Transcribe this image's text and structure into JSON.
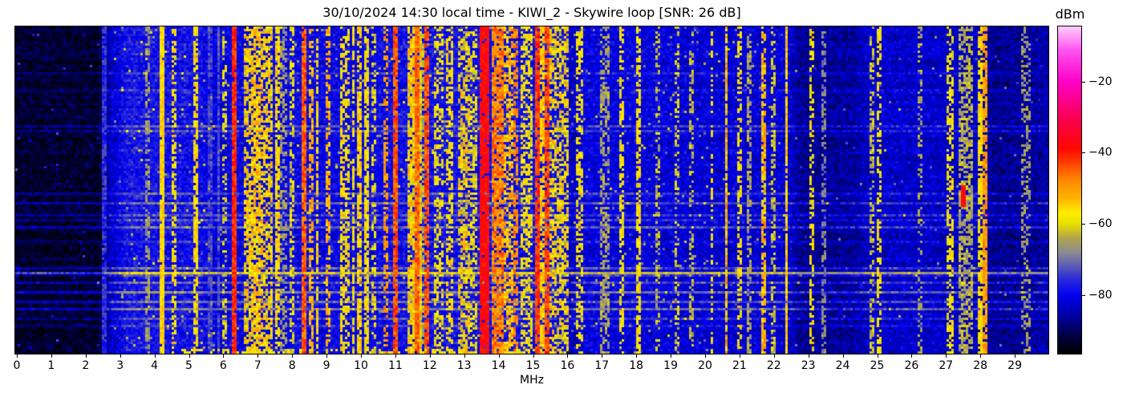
{
  "figure": {
    "kind": "radio spectrum waterfall screenshot"
  },
  "chart_data": {
    "type": "heatmap",
    "title": "30/10/2024 14:30 local time - KIWI_2 - Skywire loop [SNR: 26 dB]",
    "xlabel": "MHz",
    "x_range": [
      0,
      30
    ],
    "x_ticks": [
      0,
      1,
      2,
      3,
      4,
      5,
      6,
      7,
      8,
      9,
      10,
      11,
      12,
      13,
      14,
      15,
      16,
      17,
      18,
      19,
      20,
      21,
      22,
      23,
      24,
      25,
      26,
      27,
      28,
      29
    ],
    "y_ticks": [],
    "grid": false,
    "colorbar": {
      "label": "dBm",
      "ticks": [
        -20,
        -40,
        -60,
        -80
      ],
      "tick_labels": [
        "−20",
        "−40",
        "−60",
        "−80"
      ],
      "vmin": -96.5,
      "vmax": -4.5,
      "colormap_stops": [
        [
          -96.5,
          "#000000"
        ],
        [
          -91,
          "#00004a"
        ],
        [
          -86,
          "#0000a2"
        ],
        [
          -80,
          "#0202f0"
        ],
        [
          -76,
          "#2525dd"
        ],
        [
          -72,
          "#5a5ab8"
        ],
        [
          -68,
          "#8c8c92"
        ],
        [
          -64,
          "#b2a44a"
        ],
        [
          -60,
          "#e8e000"
        ],
        [
          -57,
          "#ffee00"
        ],
        [
          -53,
          "#ffb400"
        ],
        [
          -48,
          "#ff8c00"
        ],
        [
          -42,
          "#ff3300"
        ],
        [
          -39,
          "#ff0800"
        ],
        [
          -31,
          "#f8004a"
        ],
        [
          -20,
          "#ff00c8"
        ],
        [
          -11,
          "#ff55f0"
        ],
        [
          -4.5,
          "#ffccfa"
        ]
      ]
    },
    "background_noise_profile_dbm": [
      [
        0,
        -93
      ],
      [
        2.4,
        -93
      ],
      [
        2.7,
        -84
      ],
      [
        3.2,
        -78
      ],
      [
        5.3,
        -78.5
      ],
      [
        5.6,
        -81
      ],
      [
        7.6,
        -80
      ],
      [
        10,
        -80
      ],
      [
        11,
        -79
      ],
      [
        12.6,
        -78.5
      ],
      [
        15.9,
        -79
      ],
      [
        16.1,
        -84
      ],
      [
        16.4,
        -81
      ],
      [
        18,
        -81
      ],
      [
        20,
        -82
      ],
      [
        22.4,
        -82
      ],
      [
        22.8,
        -87
      ],
      [
        24.3,
        -86
      ],
      [
        24.8,
        -83
      ],
      [
        26.5,
        -83
      ],
      [
        27.9,
        -84
      ],
      [
        28.4,
        -87
      ],
      [
        29.7,
        -86
      ],
      [
        30,
        -85
      ]
    ],
    "signal_bands": [
      {
        "f": 2.54,
        "w": 0.05,
        "level": -76,
        "duty": 0.95
      },
      {
        "f": 3.8,
        "w": 0.06,
        "level": -66,
        "duty": 0.55
      },
      {
        "f": 4.24,
        "w": 0.06,
        "level": -56,
        "duty": 0.97
      },
      {
        "f": 4.59,
        "w": 0.05,
        "level": -57,
        "duty": 0.55
      },
      {
        "f": 5.17,
        "w": 0.07,
        "level": -57,
        "duty": 0.72
      },
      {
        "f": 5.63,
        "w": 0.04,
        "level": -74,
        "duty": 0.9
      },
      {
        "f": 5.85,
        "w": 0.04,
        "level": -73,
        "duty": 0.9
      },
      {
        "f": 6.04,
        "w": 0.05,
        "level": -61,
        "duty": 0.45
      },
      {
        "f": 6.32,
        "w": 0.05,
        "level": -41,
        "duty": 0.97
      },
      {
        "f": 6.7,
        "w": 0.2,
        "level": -57,
        "duty": 0.62,
        "jitter": 7
      },
      {
        "f": 7.0,
        "w": 0.3,
        "level": -55,
        "duty": 0.72,
        "jitter": 7
      },
      {
        "f": 7.3,
        "w": 0.2,
        "level": -57,
        "duty": 0.6,
        "jitter": 7
      },
      {
        "f": 7.55,
        "w": 0.06,
        "level": -56,
        "duty": 0.8
      },
      {
        "f": 7.75,
        "w": 0.1,
        "level": -66,
        "duty": 0.5
      },
      {
        "f": 7.97,
        "w": 0.06,
        "level": -60,
        "duty": 0.5
      },
      {
        "f": 8.35,
        "w": 0.08,
        "level": -45,
        "duty": 0.9,
        "jitter": 5
      },
      {
        "f": 8.55,
        "w": 0.05,
        "level": -52,
        "duty": 0.55
      },
      {
        "f": 8.72,
        "w": 0.05,
        "level": -57,
        "duty": 0.7
      },
      {
        "f": 9.05,
        "w": 0.05,
        "level": -52,
        "duty": 0.5
      },
      {
        "f": 9.45,
        "w": 0.08,
        "level": -57,
        "duty": 0.6
      },
      {
        "f": 9.62,
        "w": 0.06,
        "level": -58,
        "duty": 0.55
      },
      {
        "f": 9.78,
        "w": 0.06,
        "level": -57,
        "duty": 0.6
      },
      {
        "f": 9.95,
        "w": 0.06,
        "level": -55,
        "duty": 0.7
      },
      {
        "f": 10.16,
        "w": 0.05,
        "level": -57,
        "duty": 0.8
      },
      {
        "f": 10.35,
        "w": 0.05,
        "level": -60,
        "duty": 0.45
      },
      {
        "f": 10.7,
        "w": 0.05,
        "level": -50,
        "duty": 0.55
      },
      {
        "f": 11.0,
        "w": 0.05,
        "level": -44,
        "duty": 0.95
      },
      {
        "f": 11.55,
        "w": 0.35,
        "level": -56,
        "duty": 0.78,
        "jitter": 7
      },
      {
        "f": 11.62,
        "w": 0.05,
        "level": -45,
        "duty": 0.85
      },
      {
        "f": 11.78,
        "w": 0.1,
        "level": -64,
        "duty": 0.6
      },
      {
        "f": 11.9,
        "w": 0.05,
        "level": -44,
        "duty": 0.85
      },
      {
        "f": 12.2,
        "w": 0.06,
        "level": -58,
        "duty": 0.5
      },
      {
        "f": 12.35,
        "w": 0.05,
        "level": -58,
        "duty": 0.45
      },
      {
        "f": 12.6,
        "w": 0.12,
        "level": -57,
        "duty": 0.55
      },
      {
        "f": 13.0,
        "w": 0.3,
        "level": -58,
        "duty": 0.6,
        "jitter": 8
      },
      {
        "f": 13.3,
        "w": 0.15,
        "level": -60,
        "duty": 0.5
      },
      {
        "f": 13.6,
        "w": 0.22,
        "level": -38,
        "duty": 0.96,
        "jitter": 3
      },
      {
        "f": 13.95,
        "w": 0.3,
        "level": -48,
        "duty": 0.85,
        "jitter": 6
      },
      {
        "f": 14.3,
        "w": 0.25,
        "level": -53,
        "duty": 0.6,
        "jitter": 7
      },
      {
        "f": 14.5,
        "w": 0.08,
        "level": -48,
        "duty": 0.6
      },
      {
        "f": 14.8,
        "w": 0.3,
        "level": -58,
        "duty": 0.55
      },
      {
        "f": 15.15,
        "w": 0.07,
        "level": -42,
        "duty": 0.9
      },
      {
        "f": 15.27,
        "w": 0.12,
        "level": -55,
        "duty": 0.7
      },
      {
        "f": 15.38,
        "w": 0.07,
        "level": -43,
        "duty": 0.85
      },
      {
        "f": 15.75,
        "w": 0.5,
        "level": -58,
        "duty": 0.58,
        "jitter": 7
      },
      {
        "f": 16.35,
        "w": 0.2,
        "level": -58,
        "duty": 0.5
      },
      {
        "f": 17.07,
        "w": 0.18,
        "level": -65,
        "duty": 0.5
      },
      {
        "f": 17.55,
        "w": 0.06,
        "level": -58,
        "duty": 0.6
      },
      {
        "f": 18.05,
        "w": 0.05,
        "level": -57,
        "duty": 0.7
      },
      {
        "f": 18.6,
        "w": 0.05,
        "level": -63,
        "duty": 0.45
      },
      {
        "f": 19.2,
        "w": 0.05,
        "level": -62,
        "duty": 0.4
      },
      {
        "f": 19.6,
        "w": 0.04,
        "level": -63,
        "duty": 0.4
      },
      {
        "f": 20.2,
        "w": 0.05,
        "level": -58,
        "duty": 0.5
      },
      {
        "f": 20.62,
        "w": 0.06,
        "level": -54,
        "duty": 0.9,
        "jitter": 8
      },
      {
        "f": 21.0,
        "w": 0.12,
        "level": -57,
        "duty": 0.5
      },
      {
        "f": 21.3,
        "w": 0.06,
        "level": -65,
        "duty": 0.6
      },
      {
        "f": 21.7,
        "w": 0.1,
        "level": -54,
        "duty": 0.72,
        "jitter": 8
      },
      {
        "f": 21.95,
        "w": 0.07,
        "level": -62,
        "duty": 0.5
      },
      {
        "f": 22.37,
        "w": 0.05,
        "level": -55,
        "duty": 0.95
      },
      {
        "f": 23.1,
        "w": 0.05,
        "level": -58,
        "duty": 0.45
      },
      {
        "f": 23.45,
        "w": 0.04,
        "level": -68,
        "duty": 0.5
      },
      {
        "f": 24.85,
        "w": 0.04,
        "level": -62,
        "duty": 0.5
      },
      {
        "f": 25.05,
        "w": 0.08,
        "level": -57,
        "duty": 0.55
      },
      {
        "f": 26.25,
        "w": 0.05,
        "level": -65,
        "duty": 0.4
      },
      {
        "f": 27.1,
        "w": 0.15,
        "level": -58,
        "duty": 0.5
      },
      {
        "f": 27.6,
        "w": 0.35,
        "level": -64,
        "duty": 0.6
      },
      {
        "f": 28.0,
        "w": 0.06,
        "level": -57,
        "duty": 0.7
      },
      {
        "f": 28.13,
        "w": 0.04,
        "level": -50,
        "duty": 0.8
      },
      {
        "f": 29.3,
        "w": 0.2,
        "level": -66,
        "duty": 0.4
      }
    ],
    "noise_streaks": [
      {
        "t": 0.14,
        "boost": 5
      },
      {
        "t": 0.19,
        "boost": 4
      },
      {
        "t": 0.299,
        "boost": 8
      },
      {
        "t": 0.319,
        "boost": 5
      },
      {
        "t": 0.507,
        "boost": 7
      },
      {
        "t": 0.537,
        "boost": 9
      },
      {
        "t": 0.573,
        "boost": 6
      },
      {
        "t": 0.586,
        "boost": 6
      },
      {
        "t": 0.613,
        "boost": 8
      },
      {
        "t": 0.654,
        "boost": 4
      },
      {
        "t": 0.733,
        "boost": 7
      },
      {
        "t": 0.748,
        "boost": 19
      },
      {
        "t": 0.782,
        "boost": 8
      },
      {
        "t": 0.809,
        "boost": 10
      },
      {
        "t": 0.838,
        "boost": 8
      },
      {
        "t": 0.858,
        "boost": 10
      },
      {
        "t": 0.887,
        "boost": 6
      },
      {
        "t": 0.912,
        "boost": 5
      }
    ],
    "transient_burst": {
      "f_start": 27.42,
      "f_end": 27.57,
      "t_start": 0.488,
      "t_end": 0.554,
      "level": -38
    },
    "bottom_edge_activity": {
      "f_start": 4.5,
      "f_end": 15.5,
      "level": -58
    }
  }
}
